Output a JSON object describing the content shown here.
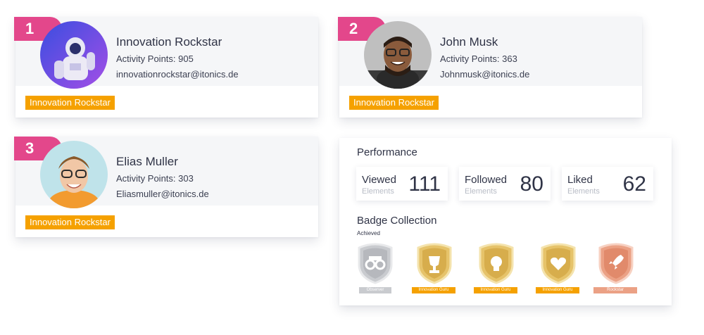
{
  "leaderboard": [
    {
      "rank": "1",
      "name": "Innovation Rockstar",
      "points": "Activity Points: 905",
      "email": "innovationrockstar@itonics.de",
      "badge": "Innovation Rockstar"
    },
    {
      "rank": "2",
      "name": "John Musk",
      "points": "Activity Points: 363",
      "email": "Johnmusk@itonics.de",
      "badge": "Innovation Rockstar"
    },
    {
      "rank": "3",
      "name": "Elias Muller",
      "points": "Activity Points: 303",
      "email": "Eliasmuller@itonics.de",
      "badge": "Innovation Rockstar"
    }
  ],
  "performance": {
    "title": "Performance",
    "stats": [
      {
        "label": "Viewed",
        "sub": "Elements",
        "value": "111"
      },
      {
        "label": "Followed",
        "sub": "Elements",
        "value": "80"
      },
      {
        "label": "Liked",
        "sub": "Elements",
        "value": "62"
      }
    ]
  },
  "badges": {
    "title": "Badge Collection",
    "subtitle": "Achieved",
    "items": [
      {
        "label": "Observer",
        "icon": "binoculars-icon",
        "style": "silver"
      },
      {
        "label": "Innovation Guru",
        "icon": "trophy-icon",
        "style": "gold"
      },
      {
        "label": "Innovation Guru",
        "icon": "lightbulb-icon",
        "style": "gold"
      },
      {
        "label": "Innovation Guru",
        "icon": "heart-icon",
        "style": "gold"
      },
      {
        "label": "Rockstar",
        "icon": "rocket-icon",
        "style": "bronze"
      }
    ]
  },
  "colors": {
    "rank": "#e3478b",
    "tag": "#f5a100",
    "silver": "#c9cbcf",
    "gold": "#e6c36a",
    "bronze": "#eba185"
  }
}
